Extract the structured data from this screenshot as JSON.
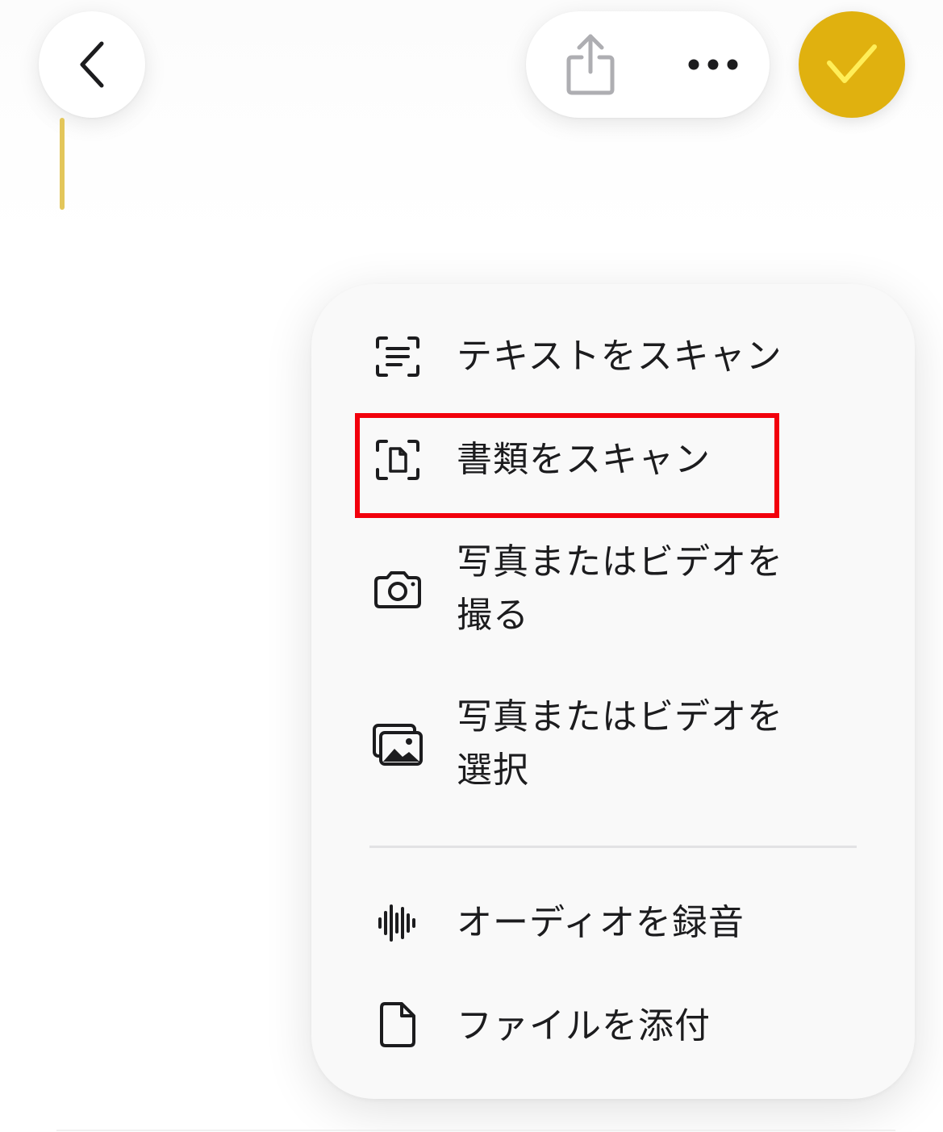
{
  "toolbar": {
    "back_icon": "chevron-left-icon",
    "share_icon": "share-icon",
    "more_icon": "ellipsis-icon",
    "done_icon": "checkmark-icon",
    "done_color": "#e0b10f"
  },
  "menu": {
    "items": [
      {
        "label": "テキストをスキャン",
        "icon": "text-scan-icon"
      },
      {
        "label": "書類をスキャン",
        "icon": "document-scan-icon",
        "highlighted": true
      },
      {
        "label": "写真またはビデオを撮る",
        "icon": "camera-icon"
      },
      {
        "label": "写真またはビデオを選択",
        "icon": "photo-library-icon"
      },
      {
        "label": "オーディオを録音",
        "icon": "waveform-icon"
      },
      {
        "label": "ファイルを添付",
        "icon": "document-icon"
      }
    ]
  },
  "annotation": {
    "highlight_color": "#f2000c"
  }
}
